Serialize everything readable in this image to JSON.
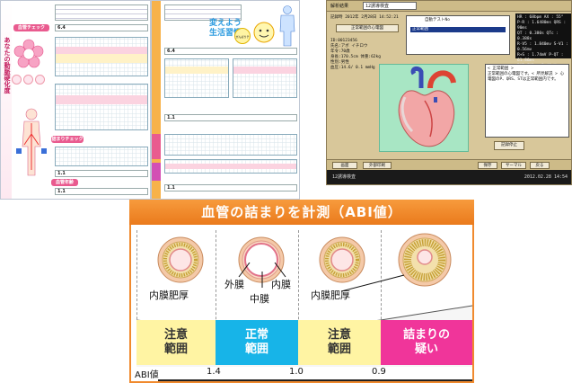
{
  "report": {
    "sheet1_vertical_title": "あなたの動脈硬化度",
    "sheet1_tag_top": "血管チェック",
    "sheet1_tag_mid": "詰まりチェック",
    "sheet1_tag_low": "血管年齢",
    "sheet1_value_top": "6.4",
    "sheet1_value_low": "1.1",
    "sheet1_value_low2": "1.1",
    "sheet2_title_line1": "変えよう",
    "sheet2_title_line2": "生活習慣！",
    "sheet2_badge": "がんばりチェック",
    "sheet2_value_top": "6.4",
    "sheet2_value_mid": "1.1",
    "sheet2_value_low": "1.1"
  },
  "ecg": {
    "window_title": "解析結果",
    "tab_label": "12誘導検査",
    "timestamp": "記録時 2012年 2月28日 14:52:21",
    "button_normal": "正常範囲の心電図",
    "header_right": "自動テストNo",
    "finding": "正常範囲",
    "patient_id": "ID:00123456",
    "patient_name": "氏名:アボ イチロウ",
    "patient_age": "年令:70歳",
    "patient_height": "身長:170.5cm  体重:62kg",
    "patient_sex": "性別:男性",
    "patient_misc": "血圧:14.6/ 0.1 mmHg",
    "params": [
      "HR : 68bpm  AX : 55°",
      "P-R : 1.6480ms  QRS : 90ms",
      "QT : 0.380s  QTc : 0.388s",
      "R-V5 : 1.840mv  S-V1 : 0.56mv",
      "R+S : 1.74mV  P-QT : 61.86ms",
      "RV5+SV1 : 2.40mV"
    ],
    "notes_title": "< 正常範囲 >",
    "notes_body": "正常範囲の心電図です。< 所見解説 > 心電図のP、QRS、STは正常範囲内です。",
    "stop_button": "記録停止",
    "bar_buttons": [
      "画面",
      "外部印刷",
      "保存",
      "サーマル",
      "戻る"
    ],
    "status_left": "12誘導検査",
    "status_right": "2012.02.28 14:54"
  },
  "abi": {
    "title": "血管の詰まりを計測（ABI値）",
    "label_inner_thick_left": "内膜肥厚",
    "label_outer": "外膜",
    "label_inner": "内膜",
    "label_middle": "中膜",
    "label_inner_thick_right": "内膜肥厚",
    "zones": [
      {
        "line1": "注意",
        "line2": "範囲",
        "color": "#fff4a3",
        "text_color": "#333333"
      },
      {
        "line1": "正常",
        "line2": "範囲",
        "color": "#17b4e8",
        "text_color": "#ffffff"
      },
      {
        "line1": "注意",
        "line2": "範囲",
        "color": "#fff4a3",
        "text_color": "#333333"
      },
      {
        "line1": "詰まりの",
        "line2": "疑い",
        "color": "#f0359a",
        "text_color": "#ffffff"
      }
    ],
    "axis_label": "ABI値",
    "ticks": [
      "1.4",
      "1.0",
      "0.9"
    ]
  }
}
